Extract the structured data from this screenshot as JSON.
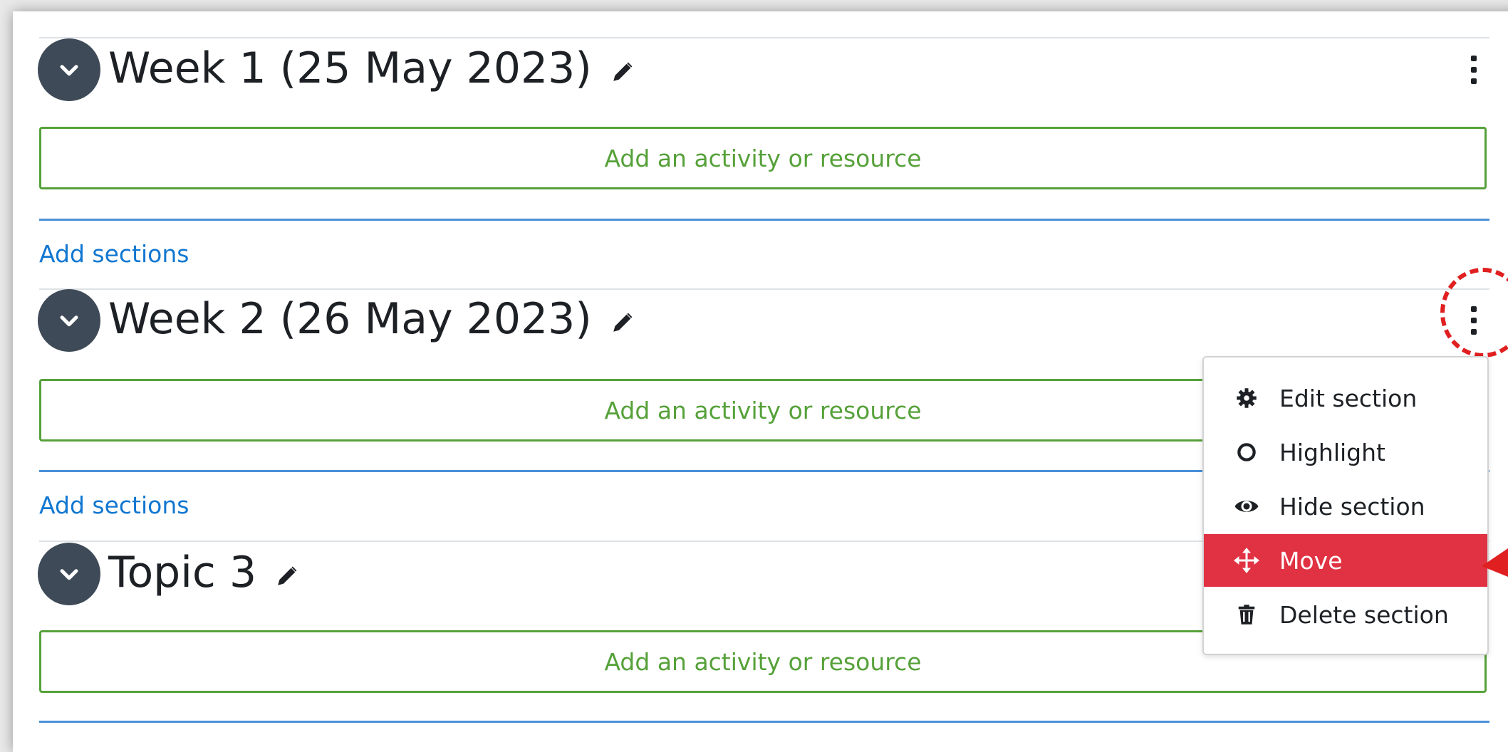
{
  "colors": {
    "accent_green": "#56a13a",
    "link_blue": "#1177d1",
    "menu_active": "#e03242",
    "collapse_button": "#3e4a57"
  },
  "sections": [
    {
      "title": "Week 1 (25 May 2023)",
      "add_activity_label": "Add an activity or resource"
    },
    {
      "title": "Week 2 (26 May 2023)",
      "add_activity_label": "Add an activity or resource"
    },
    {
      "title": "Topic 3",
      "add_activity_label": "Add an activity or resource"
    }
  ],
  "add_sections_label": "Add sections",
  "icons": {
    "collapse": "chevron-down-icon",
    "edit_title": "pencil-icon",
    "more_actions": "kebab-menu-icon"
  },
  "dropdown": {
    "items": [
      {
        "label": "Edit section",
        "icon": "gear-icon",
        "active": false
      },
      {
        "label": "Highlight",
        "icon": "circle-outline-icon",
        "active": false
      },
      {
        "label": "Hide section",
        "icon": "eye-icon",
        "active": false
      },
      {
        "label": "Move",
        "icon": "move-arrows-icon",
        "active": true
      },
      {
        "label": "Delete section",
        "icon": "trash-icon",
        "active": false
      }
    ]
  }
}
